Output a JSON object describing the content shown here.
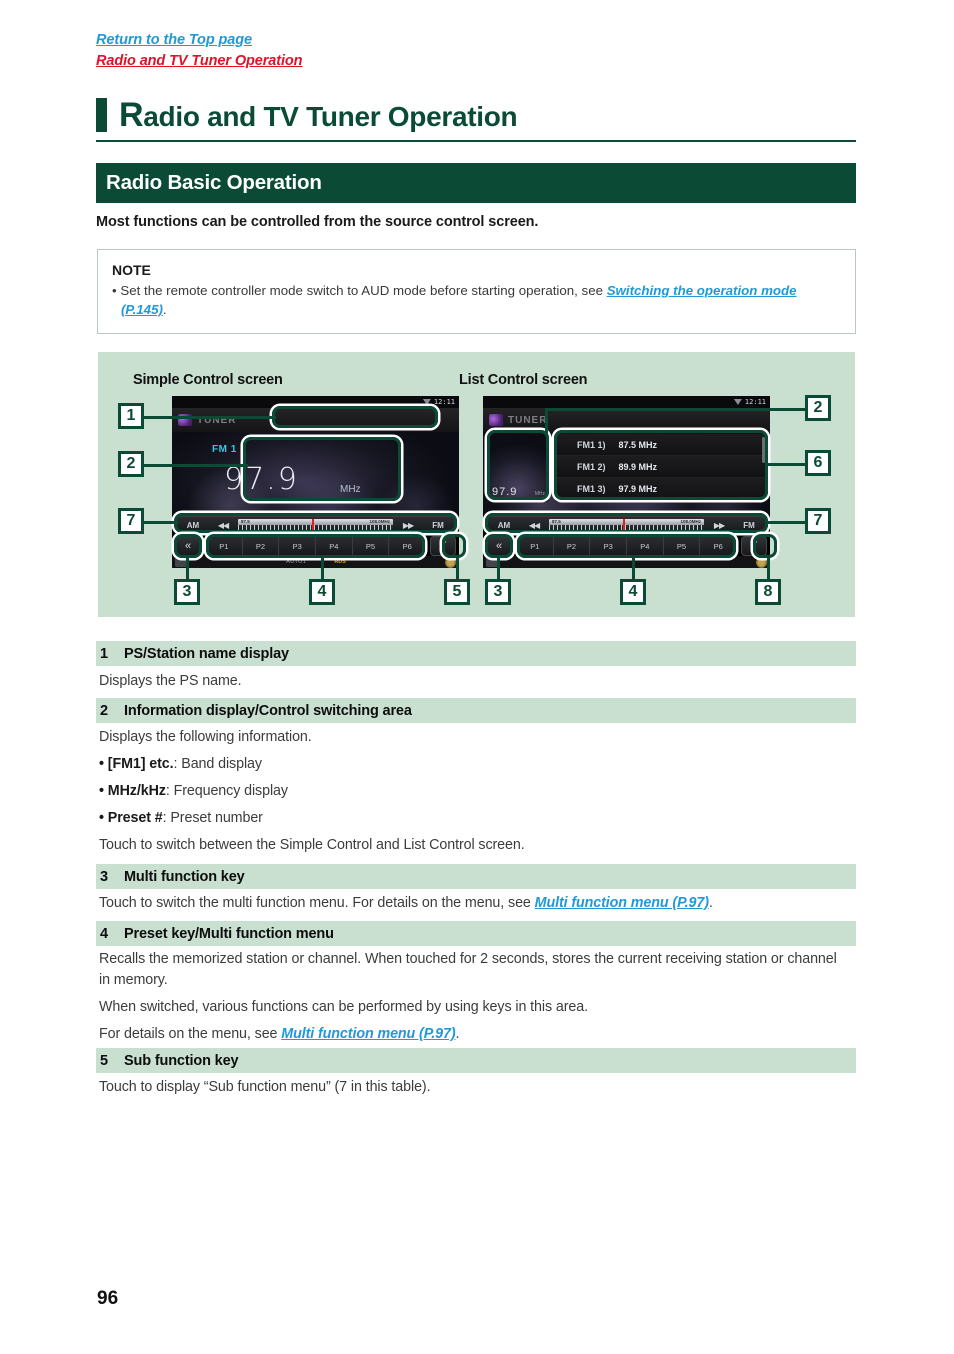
{
  "breadcrumb": {
    "top_link": "Return to the Top page",
    "current": "Radio and TV Tuner Operation"
  },
  "chapter": {
    "drop_cap": "R",
    "rest": "adio and TV Tuner Operation"
  },
  "section_banner": {
    "title": "Radio Basic Operation"
  },
  "lead": "Most functions can be controlled from the source control screen.",
  "note": {
    "title": "NOTE",
    "bullet_prefix": "• Set the remote controller mode switch to AUD mode before starting operation, see ",
    "link": "Switching the operation mode (P.145)",
    "suffix": "."
  },
  "figure": {
    "caption_left": "Simple Control screen",
    "caption_right": "List Control screen",
    "simple_screen": {
      "clock": "12:11",
      "source_label": "TUNER",
      "band": "FM 1",
      "frequency": "97.9",
      "unit": "MHz",
      "tune_left_label": "AM",
      "tune_right_label": "FM",
      "rew_icon": "◀◀",
      "ff_icon": "▶▶",
      "scale_min": "87.5",
      "scale_max": "108.0MHz",
      "multi_function_key": "«",
      "sub_function_key": "T",
      "presets": [
        "P1",
        "P2",
        "P3",
        "P4",
        "P5",
        "P6"
      ],
      "footer_mode": "AUTO1",
      "footer_rds": "RDS"
    },
    "list_screen": {
      "clock": "12:11",
      "source_label": "TUNER",
      "thumb_frequency": "97.9",
      "thumb_unit": "MHz",
      "preset_list": [
        {
          "key": "FM1 1)",
          "value": "87.5 MHz"
        },
        {
          "key": "FM1 2)",
          "value": "89.9 MHz"
        },
        {
          "key": "FM1 3)",
          "value": "97.9 MHz"
        }
      ],
      "tune_left_label": "AM",
      "tune_right_label": "FM",
      "rew_icon": "◀◀",
      "ff_icon": "▶▶",
      "scale_min": "87.5",
      "scale_max": "108.0MHz",
      "multi_function_key": "«",
      "sub_function_key": "T",
      "presets": [
        "P1",
        "P2",
        "P3",
        "P4",
        "P5",
        "P6"
      ]
    },
    "callouts": {
      "l1": "1",
      "l2": "2",
      "l7": "7",
      "r2": "2",
      "r6": "6",
      "r7": "7",
      "b3a": "3",
      "b4a": "4",
      "b5": "5",
      "b3b": "3",
      "b4b": "4",
      "b8": "8"
    }
  },
  "items": [
    {
      "num": "1",
      "title": "PS/Station name display",
      "lines": [
        {
          "text": "Displays the PS name."
        }
      ]
    },
    {
      "num": "2",
      "title": "Information display/Control switching area",
      "lines": [
        {
          "text": "Displays the following information."
        },
        {
          "bold": "• [FM1] etc.",
          "text": ": Band display"
        },
        {
          "bold": "• MHz/kHz",
          "text": ": Frequency display"
        },
        {
          "bold": "• Preset #",
          "text": ": Preset number"
        },
        {
          "text": "Touch to switch between the Simple Control and List Control screen."
        }
      ]
    },
    {
      "num": "3",
      "title": "Multi function key",
      "lines": [
        {
          "text": "Touch to switch the multi function menu. For details on the menu, see ",
          "link": "Multi function menu (P.97)",
          "after": "."
        }
      ]
    },
    {
      "num": "4",
      "title": "Preset key/Multi function menu",
      "lines": [
        {
          "text": "Recalls the memorized station or channel. When touched for 2 seconds, stores the current receiving station or channel in memory."
        },
        {
          "text": "When switched, various functions can be performed by using keys in this area."
        },
        {
          "text": "For details on the menu, see ",
          "link": "Multi function menu (P.97)",
          "after": "."
        }
      ]
    },
    {
      "num": "5",
      "title": "Sub function key",
      "lines": [
        {
          "text": "Touch to display “Sub function menu” (7 in this table)."
        }
      ]
    }
  ],
  "page_number": "96",
  "colors": {
    "dark_green": "#0b4b36",
    "sage": "#c9e0d1",
    "link_blue": "#1f9ad6",
    "crumb_red": "#e2112a"
  }
}
